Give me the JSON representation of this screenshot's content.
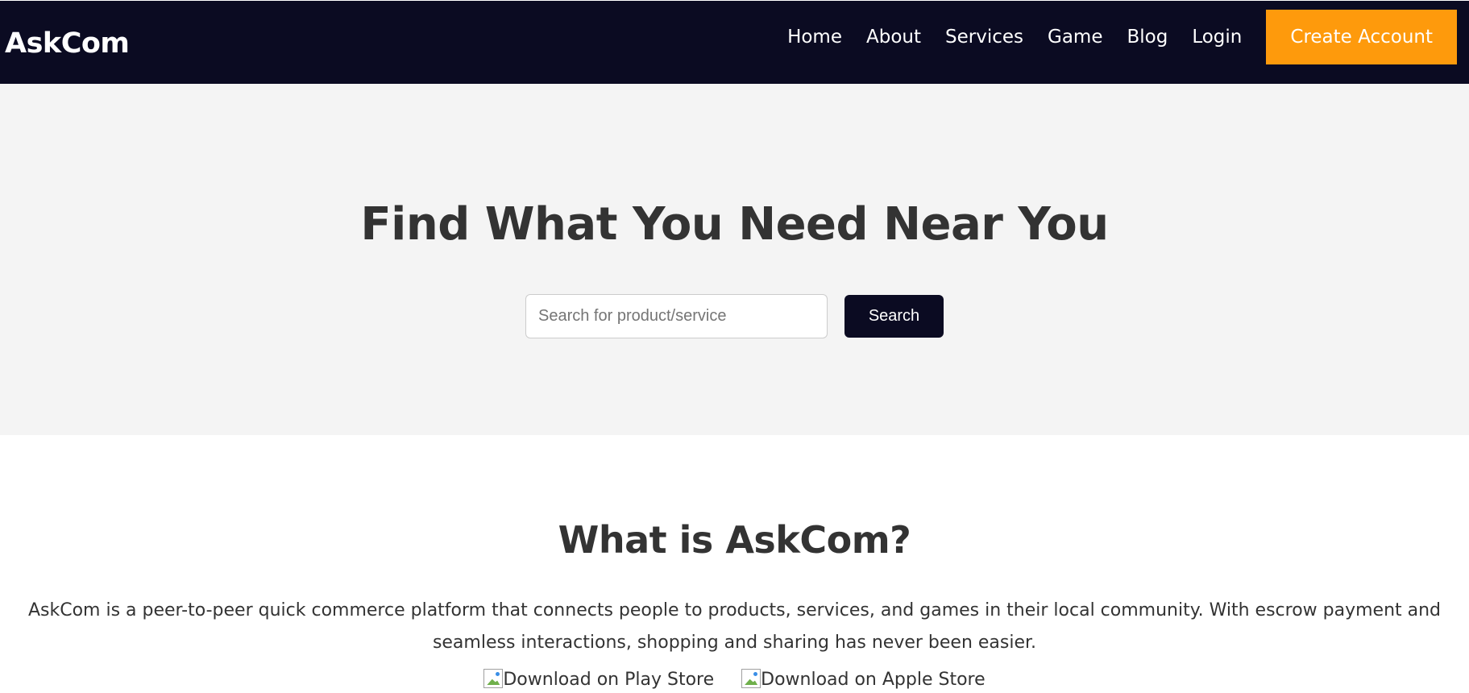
{
  "header": {
    "brand": "AskCom",
    "nav": [
      "Home",
      "About",
      "Services",
      "Game",
      "Blog",
      "Login"
    ],
    "cta_label": "Create Account",
    "background_color": "#0b0b22",
    "cta_color": "#fe9a0c"
  },
  "hero": {
    "title": "Find What You Need Near You",
    "search_placeholder": "Search for product/service",
    "search_value": "",
    "search_button_label": "Search",
    "background_color": "#f4f4f4"
  },
  "about": {
    "title": "What is AskCom?",
    "description": "AskCom is a peer-to-peer quick commerce platform that connects people to products, services, and games in their local community. With escrow payment and seamless interactions, shopping and sharing has never been easier.",
    "downloads": [
      {
        "label": "Download on Play Store",
        "icon": "broken-image-icon"
      },
      {
        "label": "Download on Apple Store",
        "icon": "broken-image-icon"
      }
    ]
  }
}
